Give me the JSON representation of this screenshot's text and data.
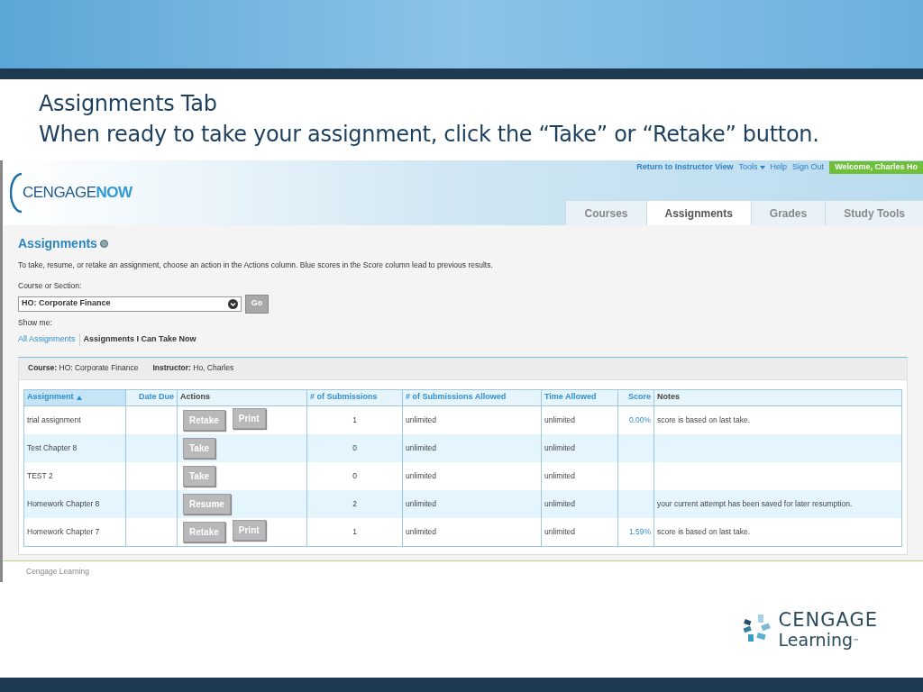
{
  "slide": {
    "title_lines": [
      "Assignments Tab",
      "When ready to take your assignment, click  the “Take” or “Retake” button."
    ]
  },
  "app": {
    "logo": {
      "left": "CENGAGE",
      "right": "NOW"
    },
    "top_links": [
      "Return to Instructor View",
      "Tools",
      "Help",
      "Sign Out"
    ],
    "welcome": "Welcome, Charles Ho",
    "tabs": [
      {
        "label": "Courses",
        "selected": false
      },
      {
        "label": "Assignments",
        "selected": true
      },
      {
        "label": "Grades",
        "selected": false
      },
      {
        "label": "Study Tools",
        "selected": false
      }
    ],
    "heading": "Assignments",
    "intro": "To take, resume, or retake an assignment, choose an action in the Actions column. Blue scores in the Score column lead to previous results.",
    "course_label": "Course or Section:",
    "course_value": "HO: Corporate Finance",
    "go": "Go",
    "show_label": "Show me:",
    "filters": [
      {
        "label": "All Assignments",
        "selected": false
      },
      {
        "label": "Assignments I Can Take Now",
        "selected": true
      }
    ],
    "info": [
      {
        "label": "Course:",
        "value": "HO: Corporate Finance"
      },
      {
        "label": "Instructor:",
        "value": "Ho, Charles"
      }
    ],
    "table": {
      "columns": [
        {
          "label": "Assignment",
          "sortable": true
        },
        {
          "label": "Date Due",
          "sortable": true
        },
        {
          "label": "Actions",
          "sortable": false
        },
        {
          "label": "# of Submissions",
          "sortable": true
        },
        {
          "label": "# of Submissions Allowed",
          "sortable": true
        },
        {
          "label": "Time Allowed",
          "sortable": true
        },
        {
          "label": "Score",
          "sortable": true
        },
        {
          "label": "Notes",
          "sortable": false
        }
      ],
      "rows": [
        {
          "name": "trial assignment",
          "actions": [
            "Retake",
            "Print"
          ],
          "submissions": "1",
          "allowed": "unlimited",
          "time": "unlimited",
          "score": "0.00%",
          "notes": "score is based on last take."
        },
        {
          "name": "Test Chapter 8",
          "actions": [
            "Take"
          ],
          "submissions": "0",
          "allowed": "unlimited",
          "time": "unlimited"
        },
        {
          "name": "TEST 2",
          "actions": [
            "Take"
          ],
          "submissions": "0",
          "allowed": "unlimited",
          "time": "unlimited"
        },
        {
          "name": "Homework Chapter 8",
          "actions": [
            "Resume"
          ],
          "submissions": "2",
          "allowed": "unlimited",
          "time": "unlimited",
          "notes": "your current attempt has been saved for later resumption."
        },
        {
          "name": "Homework Chapter 7",
          "actions": [
            "Retake",
            "Print"
          ],
          "submissions": "1",
          "allowed": "unlimited",
          "time": "unlimited",
          "score": "1.59%",
          "notes": "score is based on last take."
        }
      ]
    },
    "footer": "Cengage Learning"
  },
  "brand": {
    "name": "CENGAGE",
    "sub": "Learning",
    "tm": "™"
  }
}
